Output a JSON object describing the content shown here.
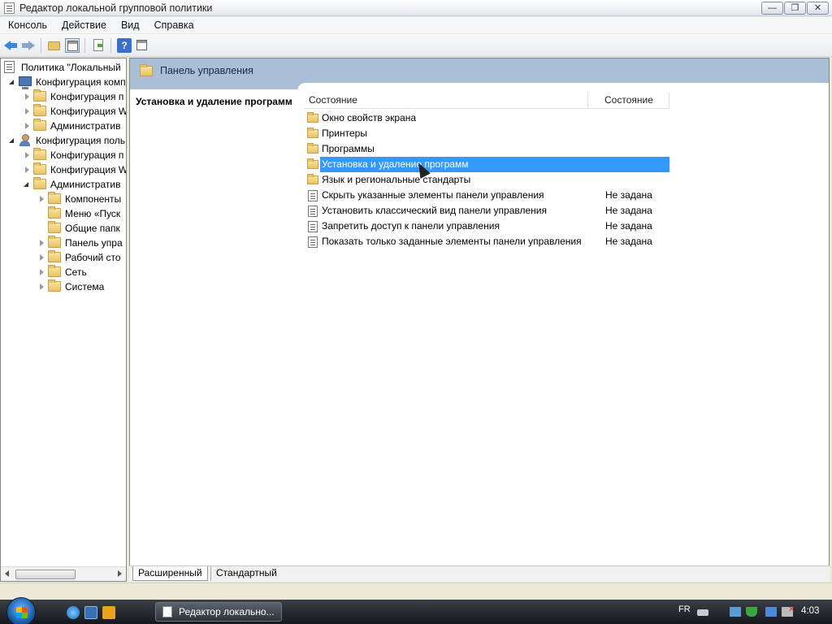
{
  "window": {
    "title": "Редактор локальной групповой политики",
    "buttons": {
      "minimize": "—",
      "maximize": "❐",
      "close": "✕"
    }
  },
  "menu": [
    "Консоль",
    "Действие",
    "Вид",
    "Справка"
  ],
  "toolbar": {
    "icons": [
      "back-arrow-icon",
      "forward-arrow-icon",
      "up-folder-icon",
      "show-hide-tree-icon",
      "export-list-icon",
      "help-icon",
      "properties-icon"
    ],
    "help_label": "?"
  },
  "tree": [
    {
      "label": "Политика \"Локальный",
      "icon": "policy-icon",
      "level": 0,
      "expander": "none"
    },
    {
      "label": "Конфигурация комп",
      "icon": "computer-icon",
      "level": 1,
      "expander": "open"
    },
    {
      "label": "Конфигурация п",
      "icon": "folder-icon",
      "level": 2,
      "expander": "closed"
    },
    {
      "label": "Конфигурация W",
      "icon": "folder-icon",
      "level": 2,
      "expander": "closed"
    },
    {
      "label": "Административ",
      "icon": "folder-icon",
      "level": 2,
      "expander": "closed"
    },
    {
      "label": "Конфигурация поль",
      "icon": "user-icon",
      "level": 1,
      "expander": "open"
    },
    {
      "label": "Конфигурация п",
      "icon": "folder-icon",
      "level": 2,
      "expander": "closed"
    },
    {
      "label": "Конфигурация W",
      "icon": "folder-icon",
      "level": 2,
      "expander": "closed"
    },
    {
      "label": "Административ",
      "icon": "folder-icon",
      "level": 2,
      "expander": "open"
    },
    {
      "label": "Компоненты",
      "icon": "folder-icon",
      "level": 3,
      "expander": "closed"
    },
    {
      "label": "Меню «Пуск",
      "icon": "folder-icon",
      "level": 3,
      "expander": "none"
    },
    {
      "label": "Общие папк",
      "icon": "folder-icon",
      "level": 3,
      "expander": "none"
    },
    {
      "label": "Панель упра",
      "icon": "folder-icon",
      "level": 3,
      "expander": "closed"
    },
    {
      "label": "Рабочий сто",
      "icon": "folder-icon",
      "level": 3,
      "expander": "closed"
    },
    {
      "label": "Сеть",
      "icon": "folder-icon",
      "level": 3,
      "expander": "closed"
    },
    {
      "label": "Система",
      "icon": "folder-icon",
      "level": 3,
      "expander": "closed"
    }
  ],
  "main": {
    "header_title": "Панель управления",
    "description_title": "Установка и удаление программ",
    "columns": {
      "name": "Состояние",
      "state": "Состояние"
    },
    "items": [
      {
        "name": "Окно свойств экрана",
        "type": "folder",
        "state": ""
      },
      {
        "name": "Принтеры",
        "type": "folder",
        "state": ""
      },
      {
        "name": "Программы",
        "type": "folder",
        "state": ""
      },
      {
        "name": "Установка и удаление программ",
        "type": "folder",
        "state": "",
        "selected": true
      },
      {
        "name": "Язык и региональные стандарты",
        "type": "folder",
        "state": ""
      },
      {
        "name": "Скрыть указанные элементы панели управления",
        "type": "setting",
        "state": "Не задана"
      },
      {
        "name": "Установить классический вид панели управления",
        "type": "setting",
        "state": "Не задана"
      },
      {
        "name": "Запретить доступ к панели управления",
        "type": "setting",
        "state": "Не задана"
      },
      {
        "name": "Показать только заданные элементы панели управления",
        "type": "setting",
        "state": "Не задана"
      }
    ],
    "tabs": {
      "extended": "Расширенный",
      "standard": "Стандартный"
    }
  },
  "taskbar": {
    "task_label": "Редактор локально...",
    "language": "FR",
    "time": "4:03"
  },
  "colors": {
    "selection": "#3399ff",
    "header": "#a9bfd6"
  }
}
